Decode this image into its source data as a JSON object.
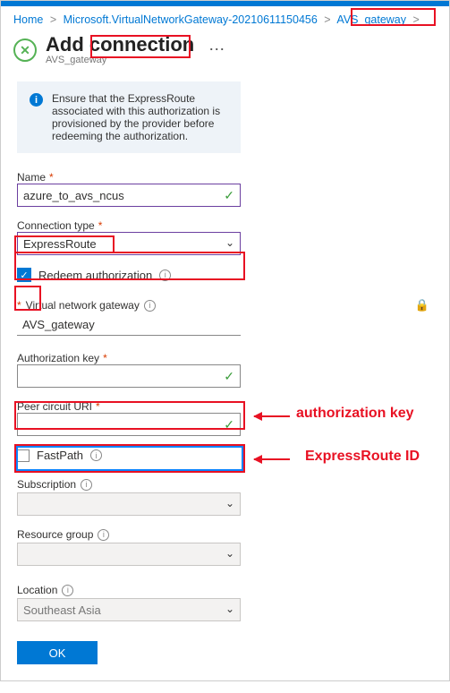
{
  "breadcrumb": {
    "home": "Home",
    "mid": "Microsoft.VirtualNetworkGateway-20210611150456",
    "leaf": "AVS_gateway"
  },
  "header": {
    "title": "Add connection",
    "subtitle": "AVS_gateway"
  },
  "info": {
    "text": "Ensure that the ExpressRoute associated with this authorization is provisioned by the provider before redeeming the authorization."
  },
  "fields": {
    "name_label": "Name",
    "name_value": "azure_to_avs_ncus",
    "conntype_label": "Connection type",
    "conntype_value": "ExpressRoute",
    "redeem_label": "Redeem authorization",
    "vng_label": "Virtual network gateway",
    "vng_value": "AVS_gateway",
    "authkey_label": "Authorization key",
    "authkey_value": "",
    "peer_label": "Peer circuit URI",
    "peer_value": "",
    "fastpath_label": "FastPath",
    "sub_label": "Subscription",
    "sub_value": "",
    "rg_label": "Resource group",
    "rg_value": "",
    "loc_label": "Location",
    "loc_value": "Southeast Asia",
    "ok_label": "OK"
  },
  "annotations": {
    "authkey": "authorization key",
    "erid": "ExpressRoute ID"
  }
}
